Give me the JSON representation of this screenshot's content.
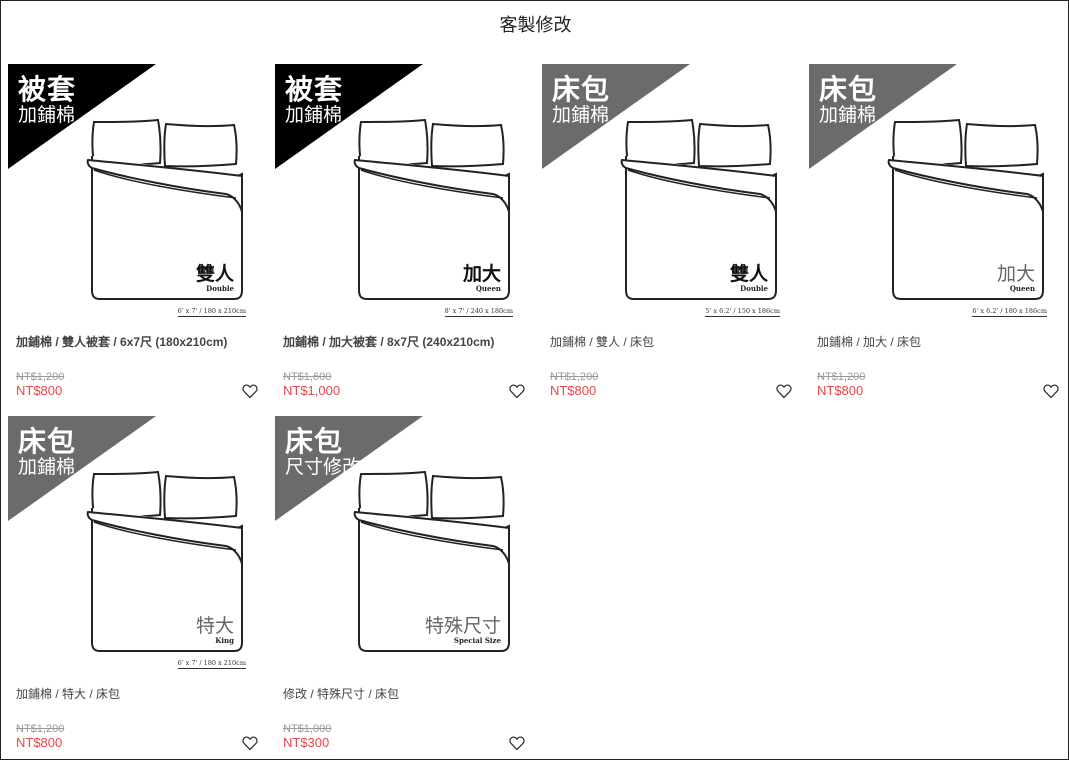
{
  "page_title": "客製修改",
  "colors": {
    "badge_black": "#000000",
    "badge_gray": "#6b6b6b",
    "price_sale": "#e8454a",
    "price_old": "#999999"
  },
  "products": [
    {
      "badge_title": "被套",
      "badge_subtitle": "加鋪棉",
      "badge_color": "#000000",
      "size_zh": "雙人",
      "size_en": "Double",
      "dims": "6' x 7' / 180 x 210cm",
      "size_light": false,
      "name": "加鋪棉 / 雙人被套 / 6x7尺 (180x210cm)",
      "name_bold_part": true,
      "price_original": "NT$1,200",
      "price_sale": "NT$800"
    },
    {
      "badge_title": "被套",
      "badge_subtitle": "加鋪棉",
      "badge_color": "#000000",
      "size_zh": "加大",
      "size_en": "Queen",
      "dims": "8' x 7' / 240 x 180cm",
      "size_light": false,
      "name": "加鋪棉 / 加大被套 / 8x7尺 (240x210cm)",
      "name_bold_part": true,
      "price_original": "NT$1,600",
      "price_sale": "NT$1,000"
    },
    {
      "badge_title": "床包",
      "badge_subtitle": "加鋪棉",
      "badge_color": "#6b6b6b",
      "size_zh": "雙人",
      "size_en": "Double",
      "dims": "5' x 6.2' / 150 x 186cm",
      "size_light": false,
      "name": "加鋪棉 / 雙人 / 床包",
      "name_bold_part": false,
      "price_original": "NT$1,200",
      "price_sale": "NT$800"
    },
    {
      "badge_title": "床包",
      "badge_subtitle": "加鋪棉",
      "badge_color": "#6b6b6b",
      "size_zh": "加大",
      "size_en": "Queen",
      "dims": "6' x 6.2' / 180 x 186cm",
      "size_light": true,
      "name": "加鋪棉 / 加大 / 床包",
      "name_bold_part": false,
      "price_original": "NT$1,200",
      "price_sale": "NT$800"
    },
    {
      "badge_title": "床包",
      "badge_subtitle": "加鋪棉",
      "badge_color": "#6b6b6b",
      "size_zh": "特大",
      "size_en": "King",
      "dims": "6' x 7' / 180 x 210cm",
      "size_light": true,
      "name": "加鋪棉 / 特大 / 床包",
      "name_bold_part": false,
      "price_original": "NT$1,200",
      "price_sale": "NT$800"
    },
    {
      "badge_title": "床包",
      "badge_subtitle": "尺寸修改",
      "badge_color": "#6b6b6b",
      "size_zh": "特殊尺寸",
      "size_en": "Special Size",
      "dims": "",
      "size_light": true,
      "name": "修改 / 特殊尺寸 / 床包",
      "name_bold_part": false,
      "price_original": "NT$1,000",
      "price_sale": "NT$300"
    }
  ]
}
